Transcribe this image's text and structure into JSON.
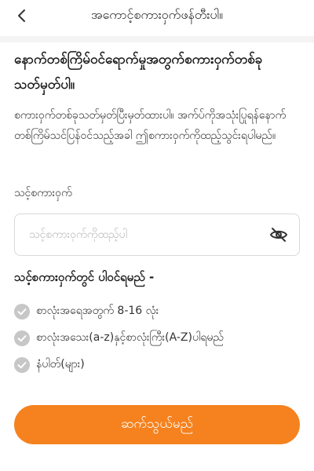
{
  "header": {
    "title": "အကောင့်စကားဝှက်ဖန်တီးပါ။",
    "back_icon": "chevron-left-icon"
  },
  "main": {
    "heading": "နောက်တစ်ကြိမ်ဝင်ရောက်မှုအတွက်စကားဝှက်တစ်ခုသတ်မှတ်ပါ။",
    "description": "စကားဝှက်တစ်ခုသတ်မှတ်ပြီးမှတ်ထားပါ။ အက်ပ်ကိုအသုံးပြုရန်နောက်တစ်ကြိမ်သင်ပြန်ဝင်သည့်အခါ ဤစကားဝှက်ကိုထည့်သွင်းရပါမည်။",
    "password_field": {
      "label": "သင့်စကားဝှက်",
      "placeholder": "သင့်စကားဝှက်ကိုထည့်ပါ",
      "value": "",
      "toggle_icon": "eye-off-icon"
    },
    "rules": {
      "title": "သင့်စကားဝှက်တွင် ပါဝင်ရမည် -",
      "items": [
        {
          "label": "စာလုံးအရေအတွက် 8-16 လုံး",
          "checked": false
        },
        {
          "label": "စာလုံးအသေး(a-z)နှင့်စာလုံးကြီး(A-Z)ပါရမည်",
          "checked": false
        },
        {
          "label": "နံပါတ်(များ)",
          "checked": false
        }
      ]
    },
    "continue_label": "ဆက်သွယ်မည်"
  },
  "colors": {
    "accent": "#f5821f",
    "check_inactive": "#c7c7c7",
    "text_primary": "#1a1a1a",
    "border": "#d9d9d9"
  }
}
